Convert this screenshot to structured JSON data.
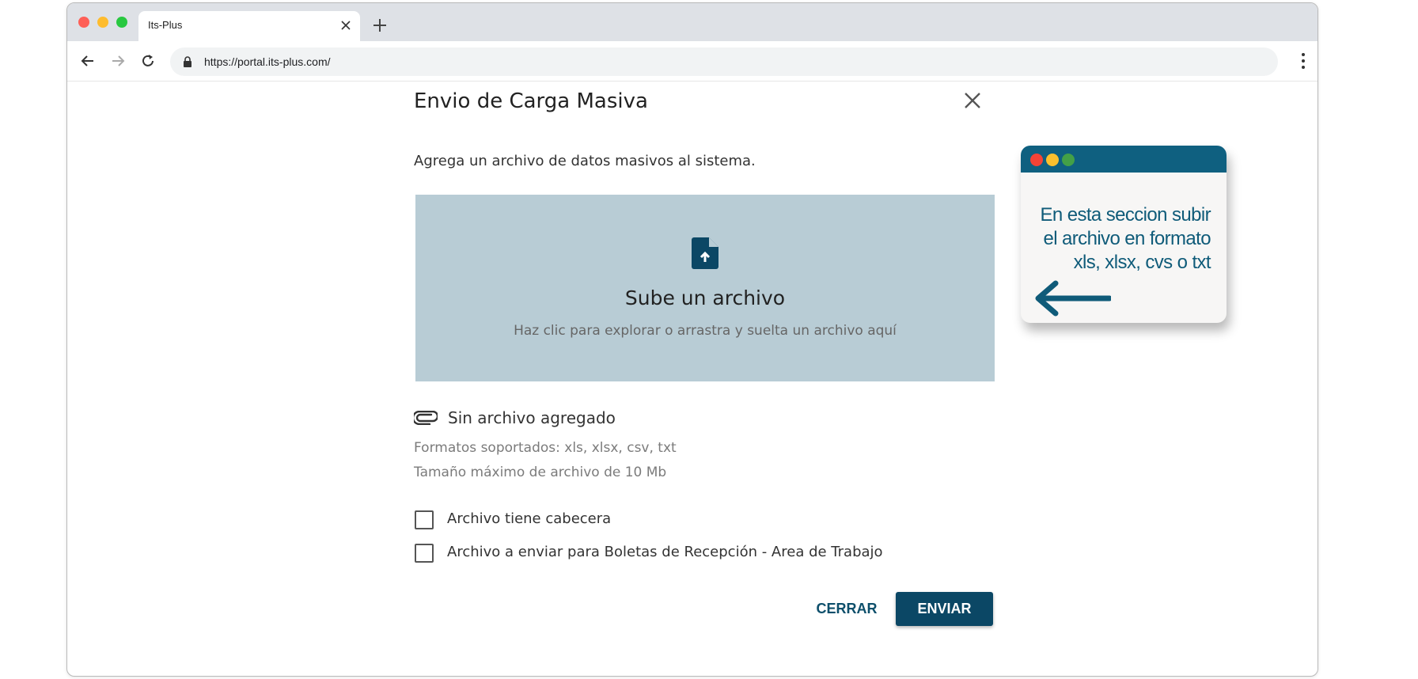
{
  "browser": {
    "tab_title": "Its-Plus",
    "url": "https://portal.its-plus.com/",
    "traffic_lights": [
      "#fe5f57",
      "#febc2e",
      "#28c840"
    ]
  },
  "dialog": {
    "title": "Envio de Carga Masiva",
    "subtitle": "Agrega un archivo de datos masivos al sistema.",
    "dropzone": {
      "icon": "file-upload-icon",
      "title": "Sube un archivo",
      "subtitle": "Haz clic para explorar o arrastra y suelta un archivo aquí"
    },
    "file_status": "Sin archivo agregado",
    "formats": "Formatos soportados: xls, xlsx, csv, txt",
    "max_size": "Tamaño máximo de archivo de 10 Mb",
    "checkboxes": [
      {
        "label": "Archivo tiene cabecera",
        "checked": false
      },
      {
        "label": "Archivo a enviar para Boletas de Recepción - Area de Trabajo",
        "checked": false
      }
    ],
    "buttons": {
      "close": "CERRAR",
      "send": "ENVIAR"
    }
  },
  "callout": {
    "lines": [
      "En esta seccion subir",
      "el archivo en formato",
      "xls, xlsx, cvs o txt"
    ],
    "dots": [
      "#f44336",
      "#fbc02d",
      "#43a047"
    ],
    "arrow": "arrow-left-icon"
  },
  "colors": {
    "accent": "#0b4765",
    "dropzone_bg": "#b8ccd5",
    "callout_bar": "#0f6080"
  }
}
